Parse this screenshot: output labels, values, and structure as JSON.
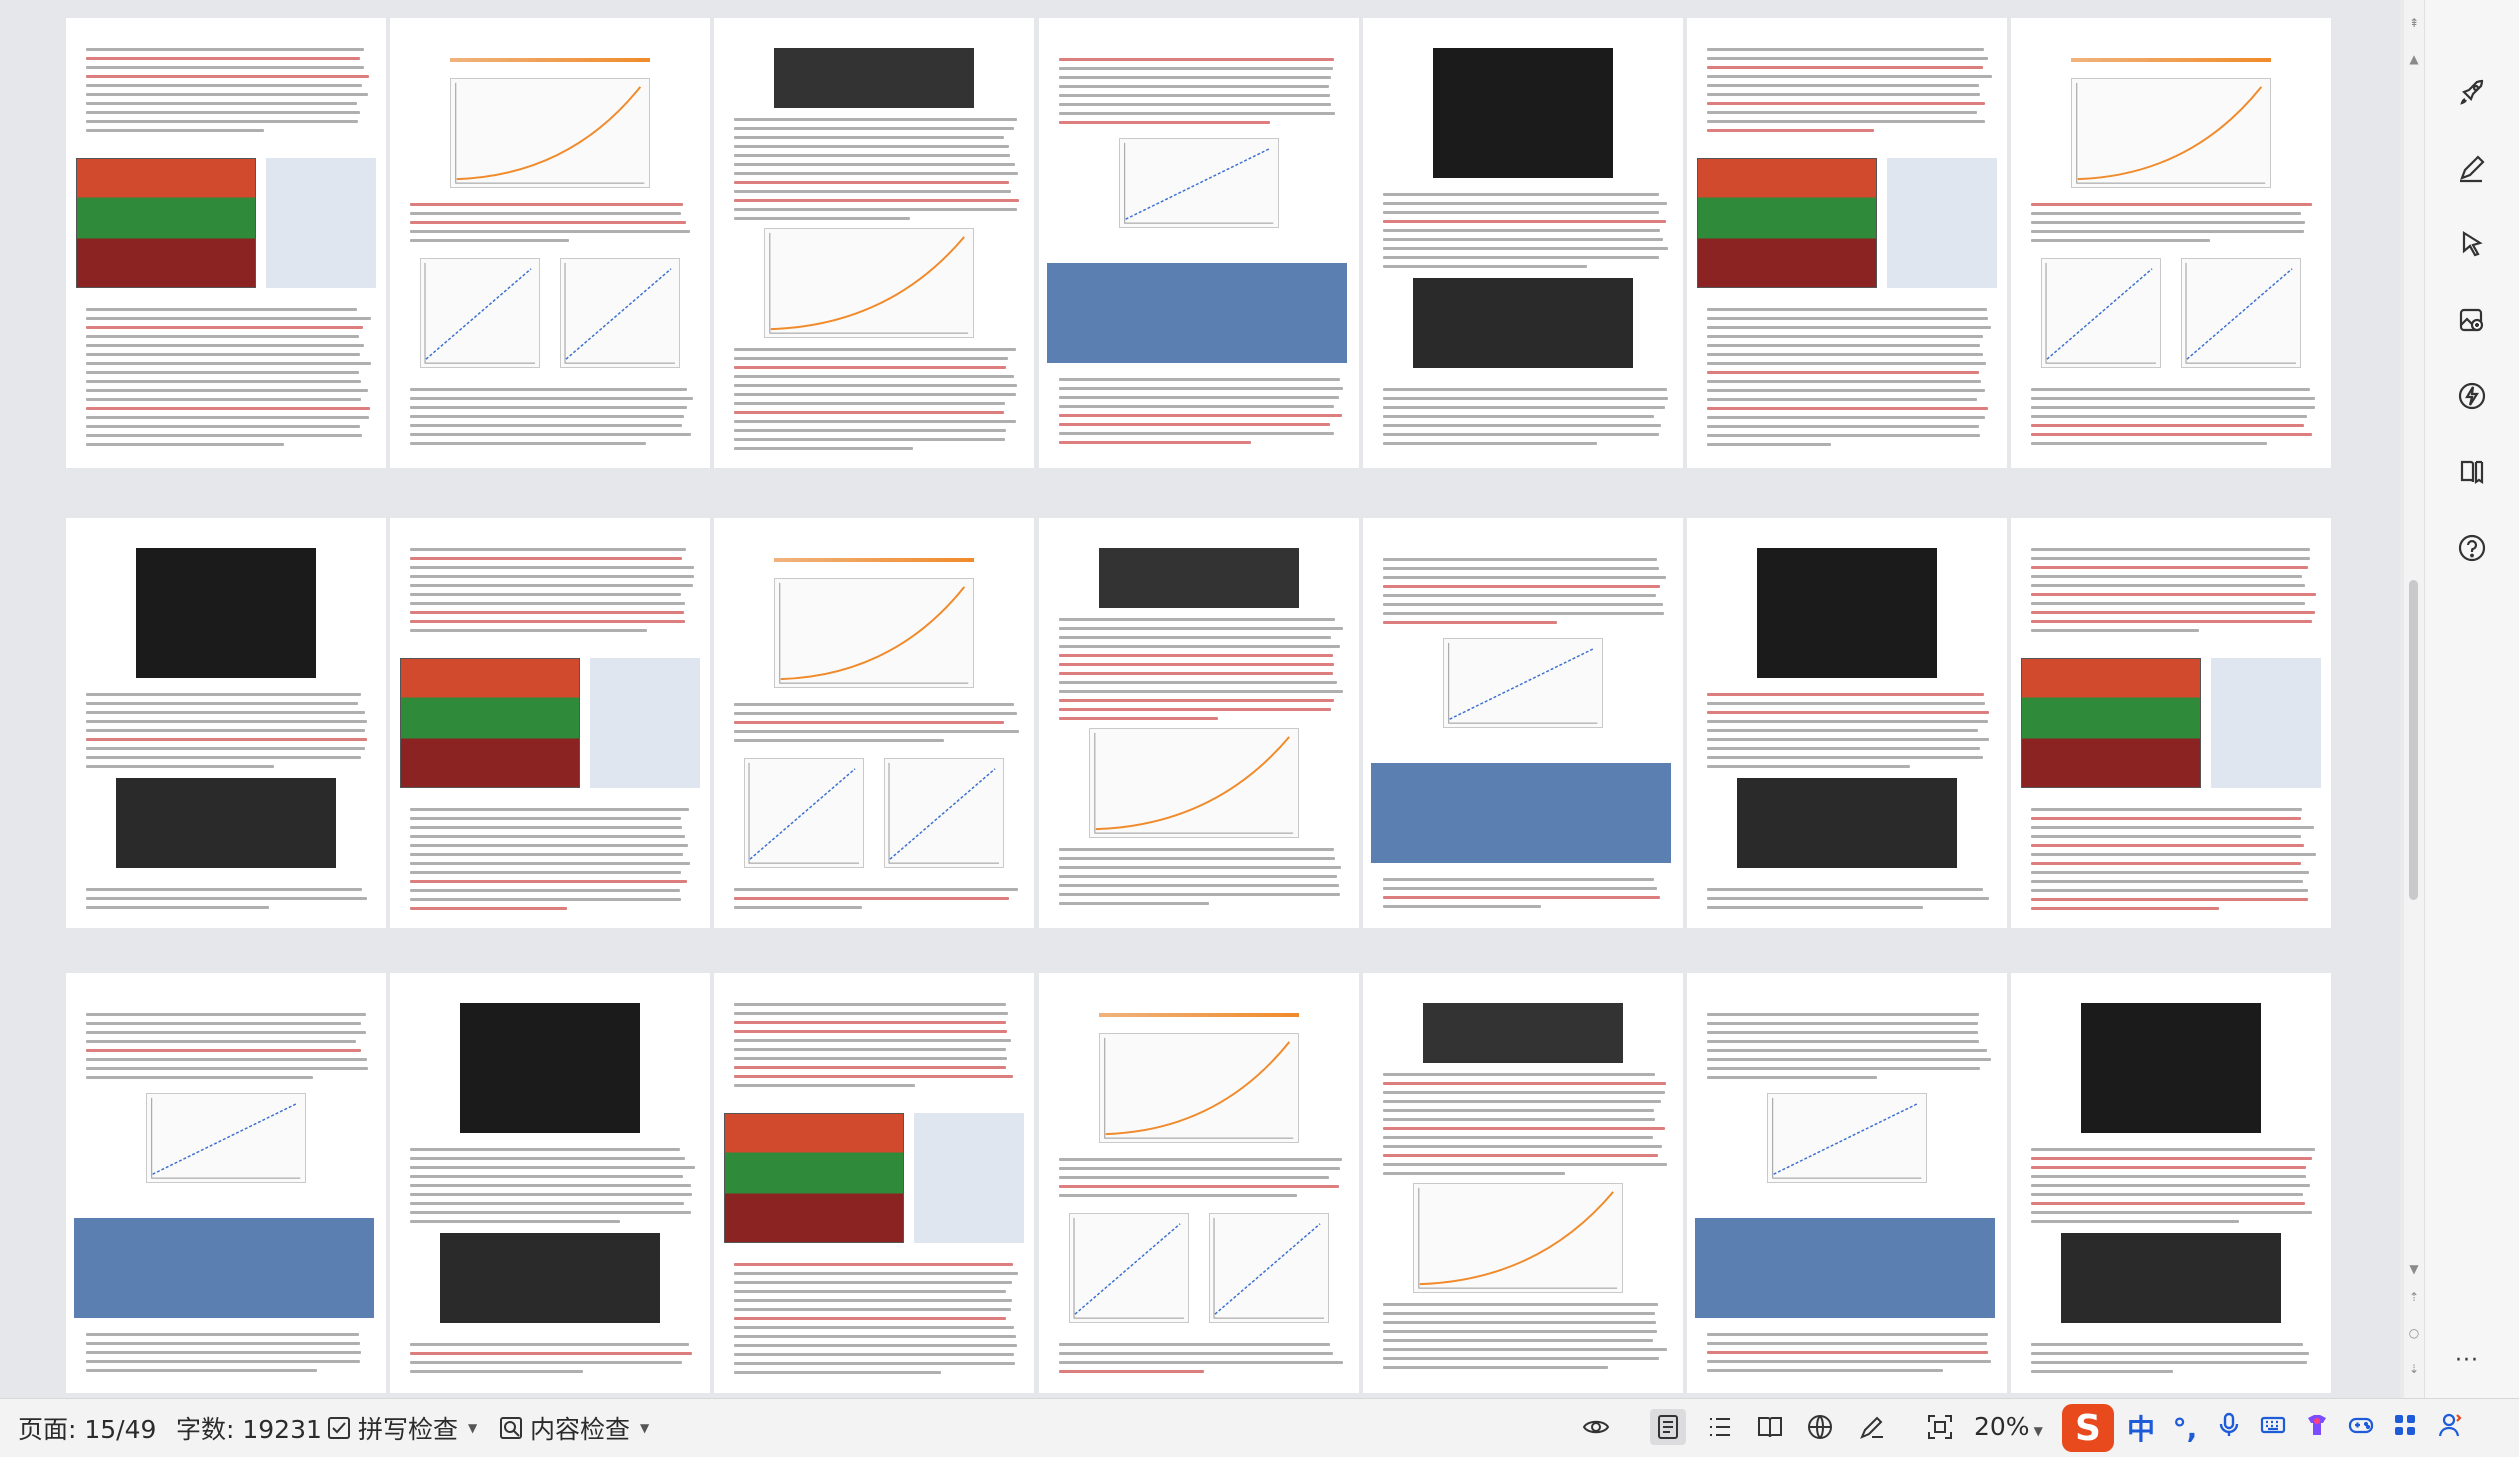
{
  "statusbar": {
    "page_indicator": "页面: 15/49",
    "word_count": "字数: 19231",
    "spellcheck_label": "拼写检查",
    "content_check_label": "内容检查",
    "zoom_level": "20%"
  },
  "ime": {
    "logo": "S",
    "lang": "中",
    "punct": "°,"
  },
  "sidebar": {
    "icons": [
      "rocket-icon",
      "pen-icon",
      "pointer-icon",
      "image-edit-icon",
      "lightning-icon",
      "book-icon",
      "help-icon"
    ],
    "more": "···"
  },
  "colors": {
    "accent_red": "#c62828",
    "ime_orange": "#e8491d",
    "ime_blue": "#1e5bd8"
  }
}
